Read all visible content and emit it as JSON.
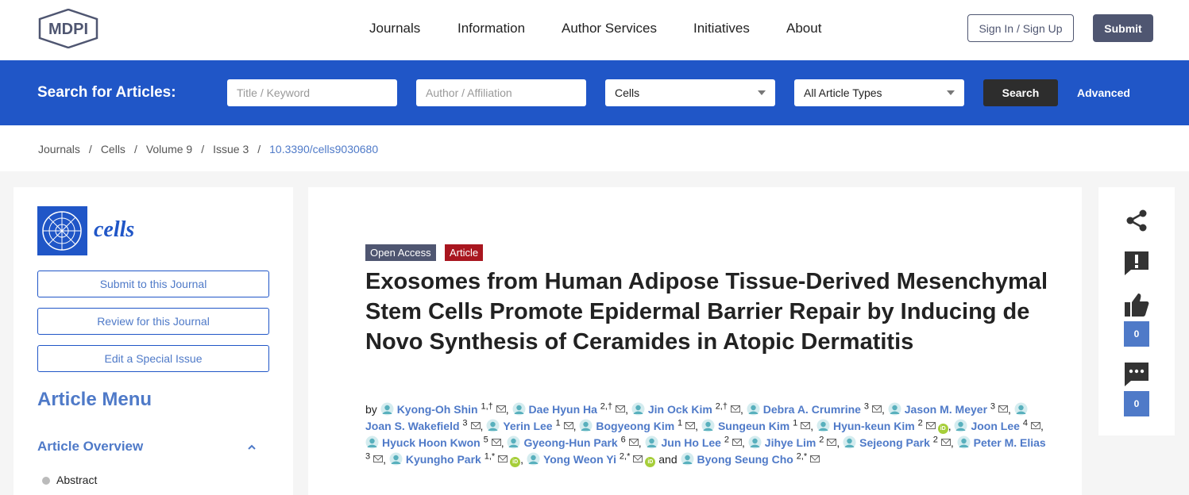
{
  "header": {
    "logo_text": "MDPI",
    "nav": [
      "Journals",
      "Information",
      "Author Services",
      "Initiatives",
      "About"
    ],
    "signin_label": "Sign In / Sign Up",
    "submit_label": "Submit"
  },
  "search": {
    "title": "Search for Articles:",
    "keyword_placeholder": "Title / Keyword",
    "author_placeholder": "Author / Affiliation",
    "journal_value": "Cells",
    "type_value": "All Article Types",
    "search_label": "Search",
    "advanced_label": "Advanced",
    "bar_color": "#2056c7"
  },
  "breadcrumb": [
    "Journals",
    "Cells",
    "Volume 9",
    "Issue 3",
    "10.3390/cells9030680"
  ],
  "sidebar": {
    "journal_name": "cells",
    "buttons": [
      "Submit to this Journal",
      "Review for this Journal",
      "Edit a Special Issue"
    ],
    "menu_title": "Article Menu",
    "section_title": "Article Overview",
    "items": [
      "Abstract"
    ]
  },
  "article": {
    "badges": [
      "Open Access",
      "Article"
    ],
    "title": "Exosomes from Human Adipose Tissue-Derived Mesenchymal Stem Cells Promote Epidermal Barrier Repair by Inducing de Novo Synthesis of Ceramides in Atopic Dermatitis",
    "by_label": "by",
    "and_label": "and",
    "authors": [
      {
        "name": "Kyong-Oh Shin",
        "aff": "1,†",
        "orcid": false
      },
      {
        "name": "Dae Hyun Ha",
        "aff": "2,†",
        "orcid": false
      },
      {
        "name": "Jin Ock Kim",
        "aff": "2,†",
        "orcid": false
      },
      {
        "name": "Debra A. Crumrine",
        "aff": "3",
        "orcid": false
      },
      {
        "name": "Jason M. Meyer",
        "aff": "3",
        "orcid": false
      },
      {
        "name": "Joan S. Wakefield",
        "aff": "3",
        "orcid": false
      },
      {
        "name": "Yerin Lee",
        "aff": "1",
        "orcid": false
      },
      {
        "name": "Bogyeong Kim",
        "aff": "1",
        "orcid": false
      },
      {
        "name": "Sungeun Kim",
        "aff": "1",
        "orcid": false
      },
      {
        "name": "Hyun-keun Kim",
        "aff": "2",
        "orcid": true
      },
      {
        "name": "Joon Lee",
        "aff": "4",
        "orcid": false
      },
      {
        "name": "Hyuck Hoon Kwon",
        "aff": "5",
        "orcid": false
      },
      {
        "name": "Gyeong-Hun Park",
        "aff": "6",
        "orcid": false
      },
      {
        "name": "Jun Ho Lee",
        "aff": "2",
        "orcid": false
      },
      {
        "name": "Jihye Lim",
        "aff": "2",
        "orcid": false
      },
      {
        "name": "Sejeong Park",
        "aff": "2",
        "orcid": false
      },
      {
        "name": "Peter M. Elias",
        "aff": "3",
        "orcid": false
      },
      {
        "name": "Kyungho Park",
        "aff": "1,*",
        "orcid": true
      },
      {
        "name": "Yong Weon Yi",
        "aff": "2,*",
        "orcid": true
      },
      {
        "name": "Byong Seung Cho",
        "aff": "2,*",
        "orcid": false
      }
    ]
  },
  "rail": {
    "like_count": "0",
    "comment_count": "0"
  },
  "icons": [
    "share-icon",
    "report-icon",
    "thumbs-up-icon",
    "comment-icon",
    "mail-icon",
    "orcid-icon",
    "author-avatar-icon",
    "chevron-up-icon"
  ]
}
